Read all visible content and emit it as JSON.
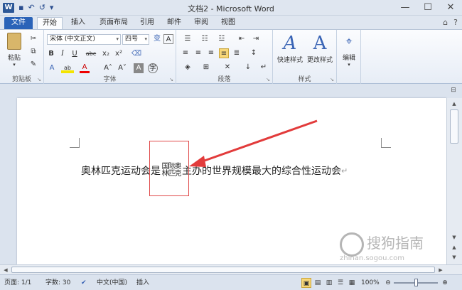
{
  "window": {
    "title": "文档2 - Microsoft Word",
    "app_icon": "W",
    "controls": [
      "—",
      "☐",
      "✕"
    ]
  },
  "qat": {
    "undo": "↶",
    "redo": "↺"
  },
  "tabs": [
    {
      "label": "文件"
    },
    {
      "label": "开始"
    },
    {
      "label": "插入"
    },
    {
      "label": "页面布局"
    },
    {
      "label": "引用"
    },
    {
      "label": "邮件"
    },
    {
      "label": "审阅"
    },
    {
      "label": "视图"
    }
  ],
  "ribbon": {
    "clipboard": {
      "label": "剪贴板",
      "paste": "粘贴"
    },
    "font": {
      "label": "字体",
      "font_name": "宋体 (中文正文)",
      "font_size": "四号",
      "bold": "B",
      "italic": "I",
      "underline": "U",
      "strike": "abc",
      "subscript": "x₂",
      "superscript": "x²",
      "grow": "A˄",
      "shrink": "A˅",
      "color_a": "A",
      "highlight": "ab"
    },
    "paragraph": {
      "label": "段落"
    },
    "styles": {
      "label": "样式",
      "quick": "快速样式",
      "change": "更改样式"
    },
    "editing": {
      "label": "编辑"
    }
  },
  "document": {
    "before": "奥林匹克运动会是",
    "combine_top": "国际奥",
    "combine_bottom": "林匹克",
    "after": "主办的世界规模最大的综合性运动会",
    "para_mark": "↵"
  },
  "status": {
    "page": "页面: 1/1",
    "words": "字数: 30",
    "lang": "中文(中国)",
    "mode": "插入",
    "zoom": "100%"
  },
  "watermark": {
    "text": "搜狗指南",
    "url": "zhinan.sogou.com"
  }
}
